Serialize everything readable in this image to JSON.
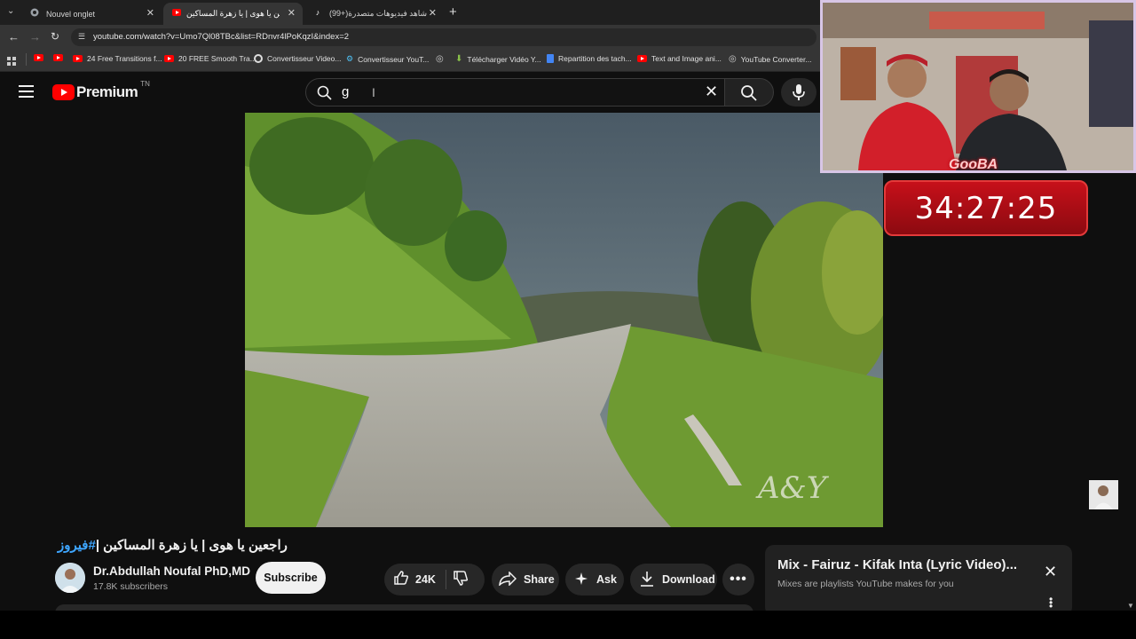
{
  "browser": {
    "tabs": [
      {
        "label": "Nouvel onglet",
        "icon": "chrome-icon"
      },
      {
        "label": "راجعين يا هوى | يا زهرة المساكين",
        "icon": "youtube-icon",
        "active": true
      },
      {
        "label": "(99+)شاهد فيديوهات متصدرة |",
        "icon": "tiktok-icon"
      }
    ],
    "url": "youtube.com/watch?v=Umo7Ql08TBc&list=RDnvr4lPoKqzI&index=2",
    "bookmarks": [
      {
        "label": ""
      },
      {
        "label": ""
      },
      {
        "label": "24 Free Transitions f..."
      },
      {
        "label": "20 FREE Smooth Tra..."
      },
      {
        "label": "Convertisseur Video..."
      },
      {
        "label": "Convertisseur YouT..."
      },
      {
        "label": ""
      },
      {
        "label": "Télécharger Vidéo Y..."
      },
      {
        "label": "Repartition des tach..."
      },
      {
        "label": "Text and Image ani..."
      },
      {
        "label": "YouTube Converter..."
      }
    ]
  },
  "youtube": {
    "logo_text": "Premium",
    "logo_region": "TN",
    "search_value": "g",
    "video": {
      "watermark": "A&Y",
      "title_hashtag": "#فيروز",
      "title_text": "راجعين يا هوى | يا زهرة المساكين |"
    },
    "channel": {
      "name": "Dr.Abdullah Noufal PhD,MD",
      "subscribers": "17.8K subscribers",
      "subscribe_label": "Subscribe"
    },
    "actions": {
      "likes": "24K",
      "share": "Share",
      "ask": "Ask",
      "download": "Download"
    },
    "mix": {
      "title": "Mix - Fairuz - Kifak Inta (Lyric Video)...",
      "subtitle": "Mixes are playlists YouTube makes for you"
    }
  },
  "overlay": {
    "stream_logo": "GooBA",
    "timer": "34:27:25"
  },
  "colors": {
    "youtube_red": "#ff0000",
    "timer_red": "#c7101a",
    "hashtag_blue": "#3ea6ff"
  }
}
